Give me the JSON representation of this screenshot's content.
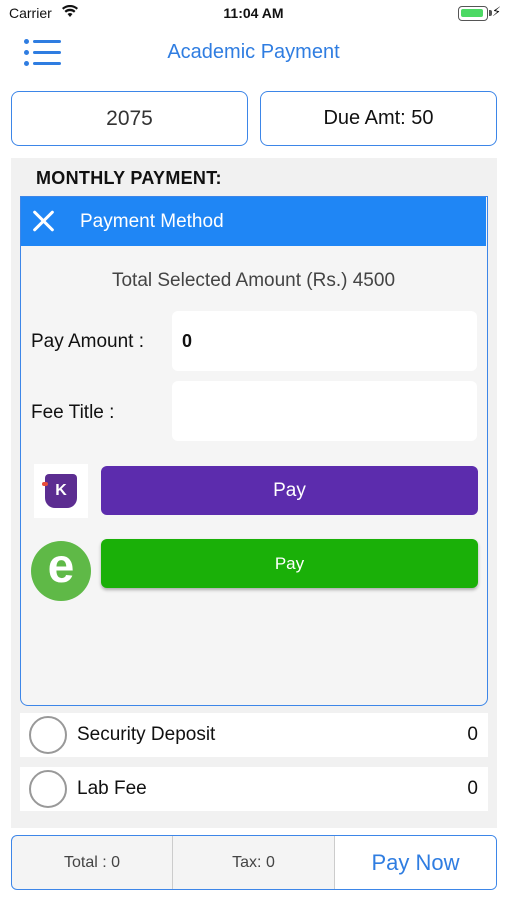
{
  "status_bar": {
    "carrier": "Carrier",
    "time": "11:04 AM"
  },
  "nav": {
    "title": "Academic Payment"
  },
  "header_boxes": {
    "year": "2075",
    "due_amount": "Due Amt: 50"
  },
  "section": {
    "title": "MONTHLY PAYMENT:"
  },
  "modal": {
    "title": "Payment Method",
    "total_selected": "Total Selected Amount (Rs.) 4500",
    "pay_amount_label": "Pay Amount :",
    "pay_amount_value": "0",
    "fee_title_label": "Fee Title :",
    "fee_title_value": "",
    "khalti": {
      "logo_letter": "K",
      "button_label": "Pay",
      "color": "#5c2cad"
    },
    "esewa": {
      "logo_letter": "e",
      "button_label": "Pay",
      "color": "#1ab008"
    }
  },
  "fees": [
    {
      "name": "Security Deposit",
      "amount": "0"
    },
    {
      "name": "Lab Fee",
      "amount": "0"
    }
  ],
  "bottom_bar": {
    "total": "Total : 0",
    "tax": "Tax: 0",
    "pay_now": "Pay Now"
  },
  "colors": {
    "accent": "#2f7de1",
    "header_blue": "#1f86f5"
  },
  "icons": [
    "wifi-icon",
    "battery-icon",
    "charging-icon",
    "menu-icon",
    "close-icon",
    "radio-icon"
  ]
}
